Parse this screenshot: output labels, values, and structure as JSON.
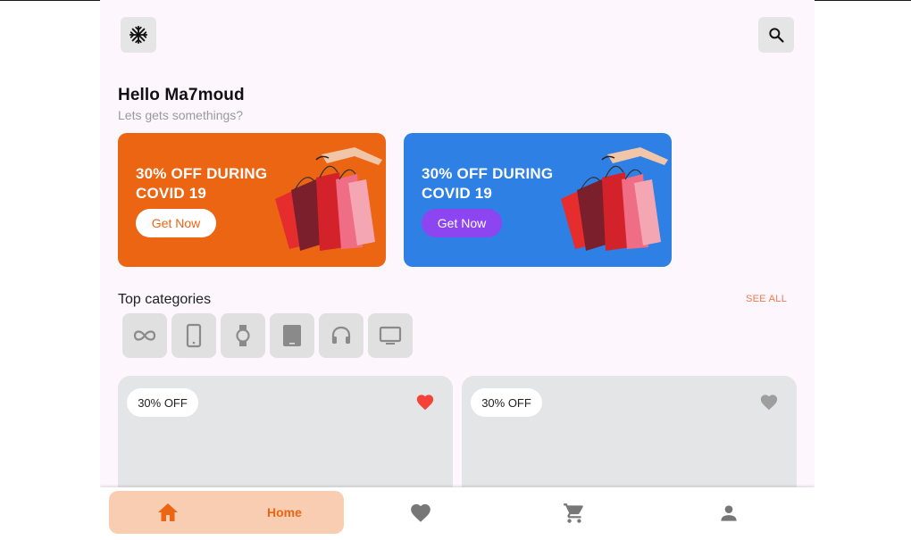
{
  "header": {
    "menu_icon": "snowflake-icon",
    "search_icon": "search-icon"
  },
  "greeting": {
    "title": "Hello Ma7moud",
    "subtitle": "Lets gets somethings?"
  },
  "banners": [
    {
      "title": "30% OFF DURING COVID 19",
      "button": "Get Now",
      "color": "#ec6513",
      "button_color": "#ffffff"
    },
    {
      "title": "30% OFF DURING COVID 19",
      "button": "Get Now",
      "color": "#2f80e4",
      "button_color": "#8c45f0"
    }
  ],
  "categories": {
    "title": "Top categories",
    "see_all": "SEE ALL",
    "items": [
      "infinity-icon",
      "smartphone-icon",
      "watch-icon",
      "tablet-icon",
      "headphones-icon",
      "tv-icon"
    ]
  },
  "products": [
    {
      "badge": "30% OFF",
      "favorite": true,
      "favorite_color": "#f44336"
    },
    {
      "badge": "30% OFF",
      "favorite": false,
      "favorite_color": "#9e9e9e"
    }
  ],
  "bottom_nav": {
    "active": "Home",
    "items": [
      "home-icon",
      "heart-icon",
      "cart-icon",
      "person-icon"
    ],
    "accent": "#ec6513"
  }
}
